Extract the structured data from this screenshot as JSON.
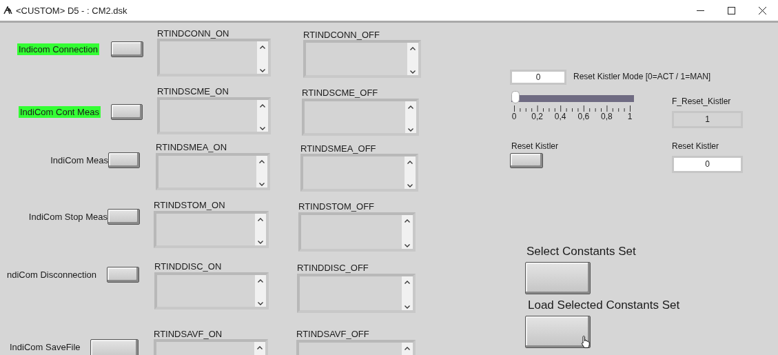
{
  "window": {
    "title": "<CUSTOM> D5 - : CM2.dsk"
  },
  "indicom_buttons": [
    {
      "label": "Indicom Connection",
      "highlighted": true
    },
    {
      "label": "IndiCom Cont Meas",
      "highlighted": true
    },
    {
      "label": "IndiCom Meas",
      "highlighted": false
    },
    {
      "label": "IndiCom Stop Meas",
      "highlighted": false
    },
    {
      "label": "ndiCom Disconnection",
      "highlighted": false
    },
    {
      "label": "IndiCom SaveFile",
      "highlighted": false
    }
  ],
  "string_indicators": [
    {
      "label": "RTINDCONN_ON"
    },
    {
      "label": "RTINDCONN_OFF"
    },
    {
      "label": "RTINDSCME_ON"
    },
    {
      "label": "RTINDSCME_OFF"
    },
    {
      "label": "RTINDSMEA_ON"
    },
    {
      "label": "RTINDSMEA_OFF"
    },
    {
      "label": "RTINDSTOM_ON"
    },
    {
      "label": "RTINDSTOM_OFF"
    },
    {
      "label": "RTINDDISC_ON"
    },
    {
      "label": "RTINDDISC_OFF"
    },
    {
      "label": "RTINDSAVF_ON"
    },
    {
      "label": "RTINDSAVF_OFF"
    }
  ],
  "reset_kistler_mode": {
    "value": "0",
    "label": "Reset Kistler Mode [0=ACT / 1=MAN]",
    "slider": {
      "level": 0,
      "tick_labels": [
        "0",
        "0,2",
        "0,4",
        "0,6",
        "0,8",
        "1"
      ]
    }
  },
  "f_reset_kistler": {
    "label": "F_Reset_Kistler",
    "value": "1"
  },
  "reset_kistler_button": {
    "label": "Reset Kistler"
  },
  "reset_kistler_indicator": {
    "label": "Reset Kistler",
    "value": "0"
  },
  "constants_buttons": [
    {
      "label": "Select Constants Set"
    },
    {
      "label": "Load Selected Constants Set"
    }
  ]
}
